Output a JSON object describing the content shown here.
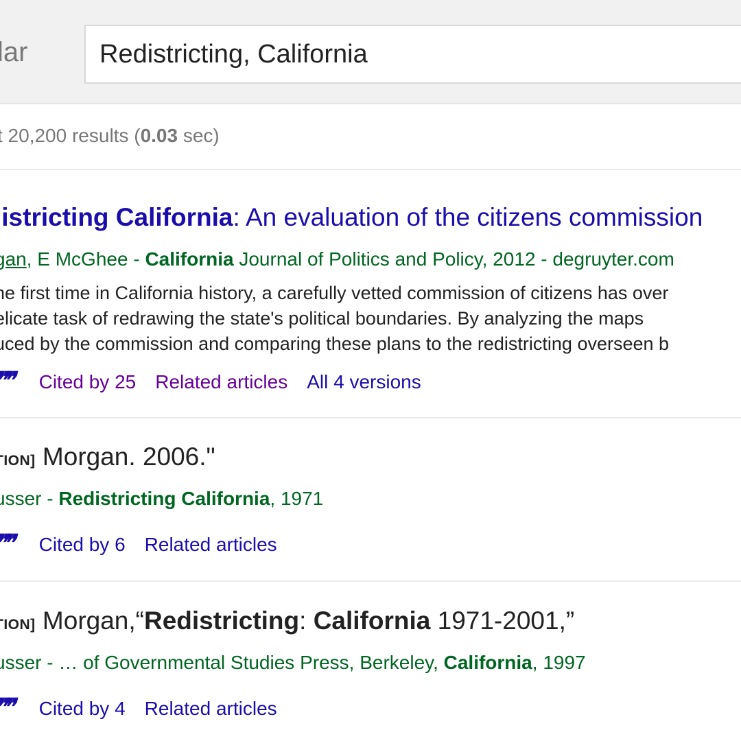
{
  "header": {
    "logo_text": "lar",
    "search_value": "Redistricting, California"
  },
  "stats": {
    "prefix": "t 20,200 results (",
    "time": "0.03",
    "suffix": " sec)"
  },
  "results": [
    {
      "title_bold": "listricting California",
      "title_rest": ": An evaluation of the citizens commission",
      "author_link": "gan",
      "meta_mid": ", E McGhee - ",
      "meta_bold": "California",
      "meta_rest": " Journal of Politics and Policy, 2012 - degruyter.com",
      "snippet": [
        "ne first time in California history, a carefully vetted commission of citizens has over",
        "elicate task of redrawing the state's political boundaries. By analyzing the maps",
        "uced by the commission and comparing these plans to the redistricting overseen b"
      ],
      "cited_by": "Cited by 25",
      "related": "Related articles",
      "versions": "All 4 versions"
    },
    {
      "tag": "TION]",
      "title_plain": " Morgan. 2006.\"",
      "meta_pre": "usser - ",
      "meta_bold": "Redistricting California",
      "meta_rest": ", 1971",
      "cited_by": "Cited by 6",
      "related": "Related articles"
    },
    {
      "tag": "TION]",
      "title_pre": " Morgan,“",
      "title_bold1": "Redistricting",
      "title_mid": ": ",
      "title_bold2": "California",
      "title_rest": " 1971-2001,”",
      "meta_pre": "usser - … of Governmental Studies Press, Berkeley, ",
      "meta_bold": "California",
      "meta_rest": ", 1997",
      "cited_by": "Cited by 4",
      "related": "Related articles"
    }
  ],
  "icons": {
    "cite": "quote-icon"
  },
  "colors": {
    "link": "#1a0dab",
    "visited": "#660099",
    "meta": "#006621"
  }
}
